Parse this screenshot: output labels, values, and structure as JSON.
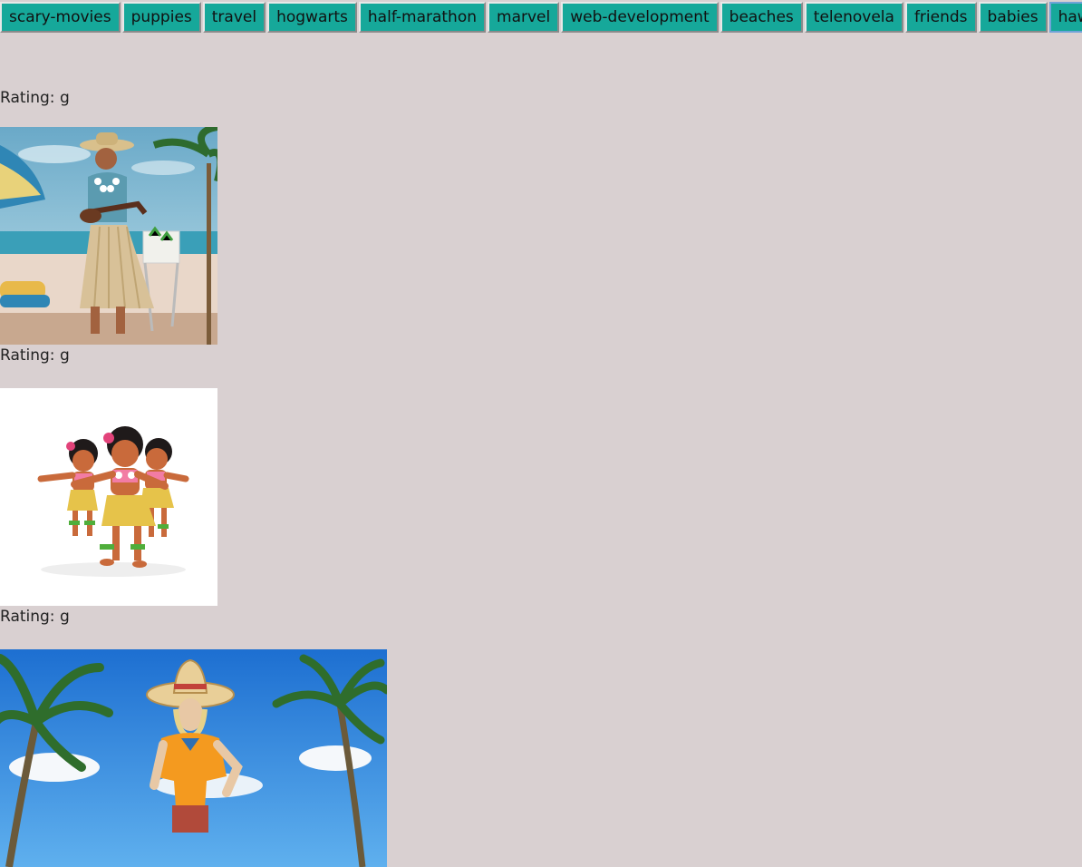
{
  "topics": [
    {
      "label": "scary-movies"
    },
    {
      "label": "puppies"
    },
    {
      "label": "travel"
    },
    {
      "label": "hogwarts"
    },
    {
      "label": "half-marathon"
    },
    {
      "label": "marvel"
    },
    {
      "label": "web-development"
    },
    {
      "label": "beaches"
    },
    {
      "label": "telenovela"
    },
    {
      "label": "friends"
    },
    {
      "label": "babies"
    },
    {
      "label": "hawaii",
      "selected": true
    }
  ],
  "results": [
    {
      "rating_text": "Rating: g",
      "image_subject": "man in grass skirt playing ukulele on beach"
    },
    {
      "rating_text": "Rating: g",
      "image_subject": "three hula dancer figurines"
    },
    {
      "rating_text": "Rating: g",
      "image_subject": "woman in sombrero under palm trees"
    }
  ],
  "colors": {
    "background": "#d9d0d1",
    "button": "#16a89a"
  }
}
